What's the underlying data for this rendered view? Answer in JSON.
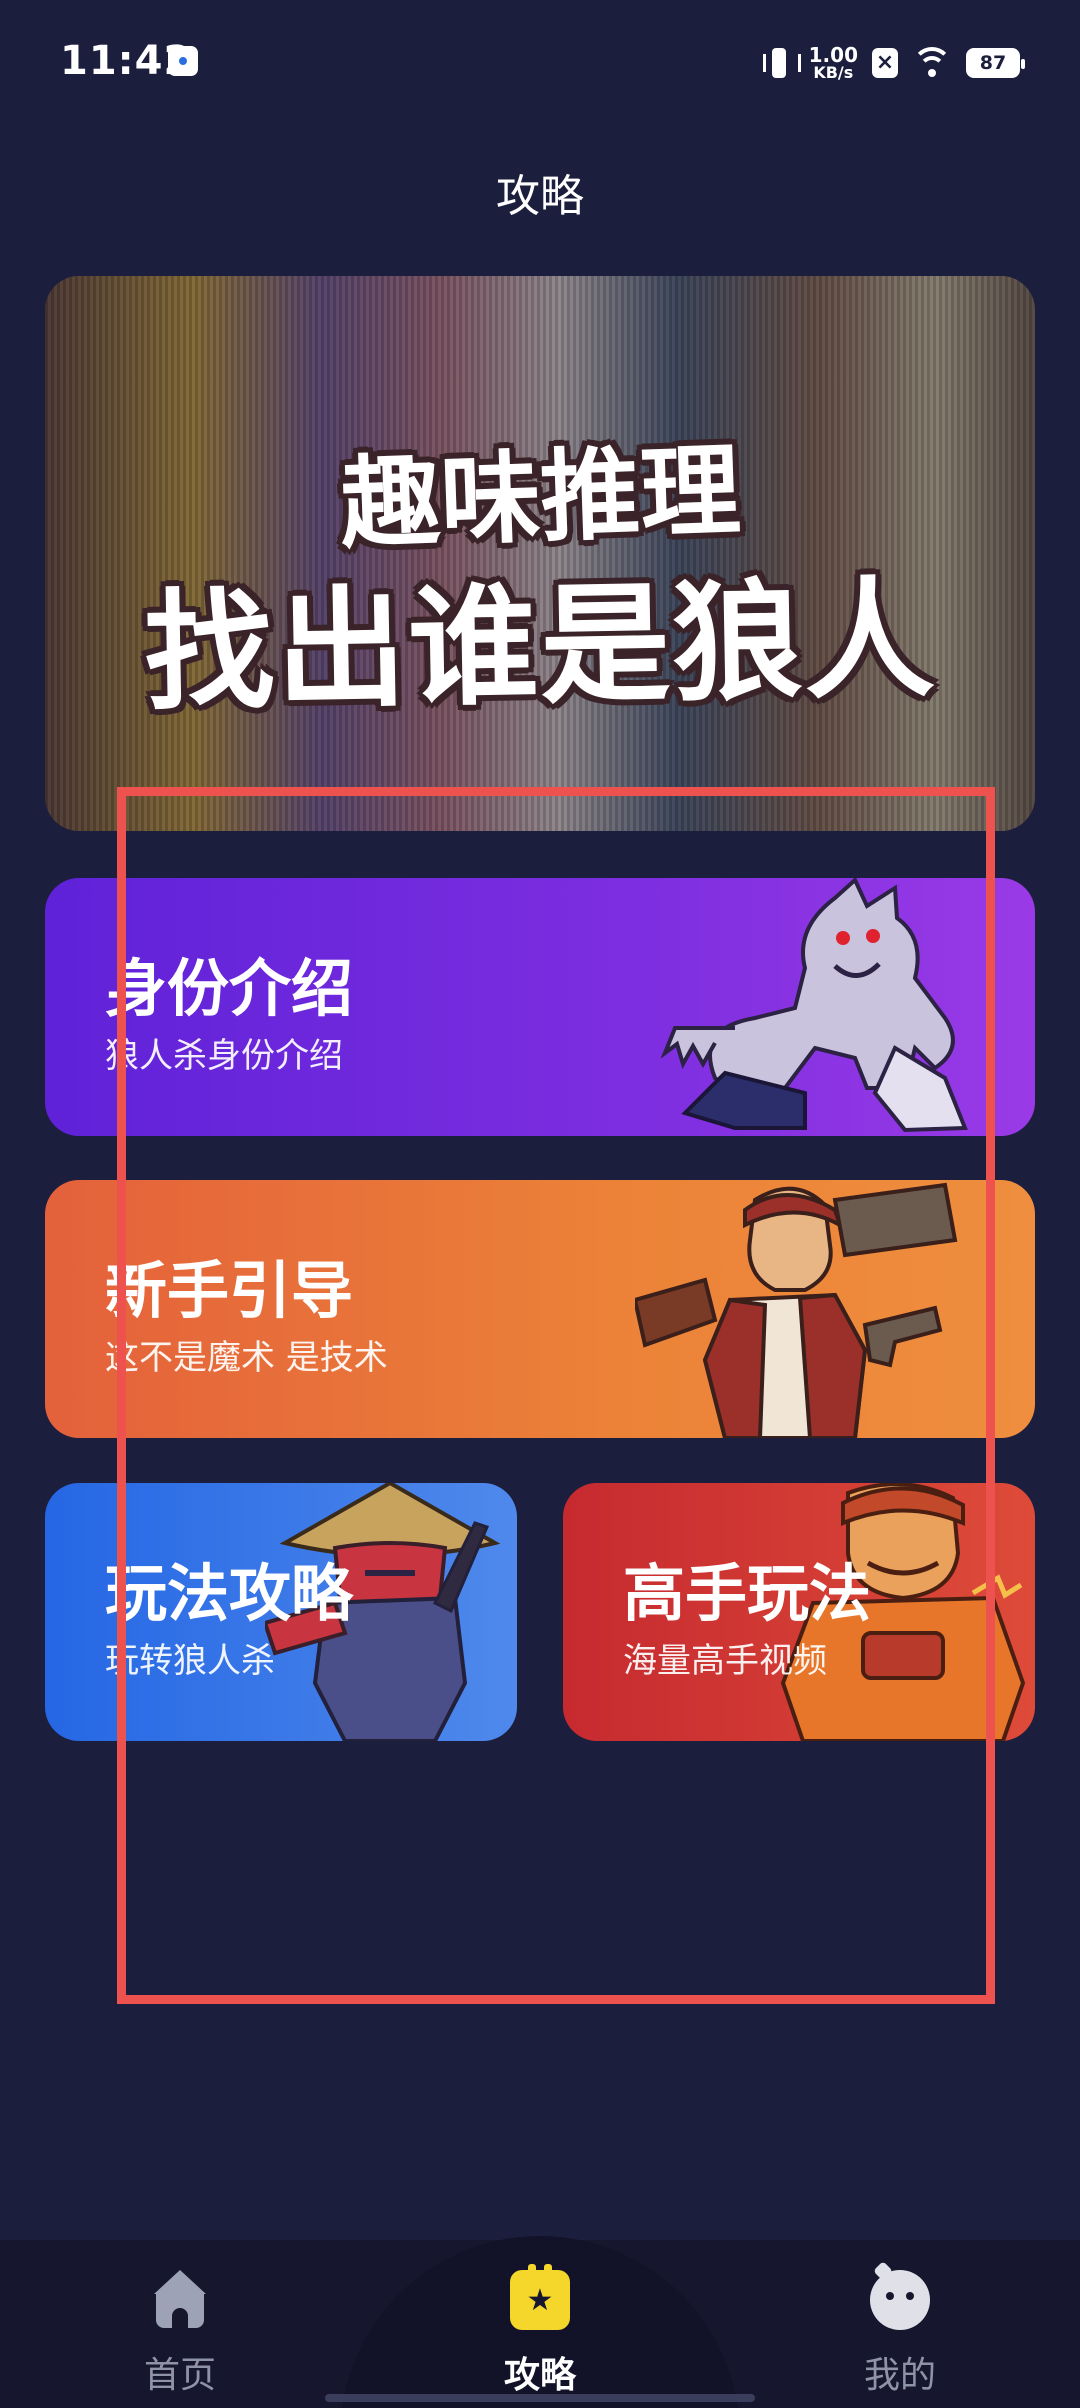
{
  "status_bar": {
    "time": "11:42",
    "net_speed_value": "1.00",
    "net_speed_unit": "KB/s",
    "battery": "87",
    "icons": [
      "app-badge-icon",
      "vibrate-icon",
      "close-box-icon",
      "wifi-icon",
      "battery-icon"
    ]
  },
  "page": {
    "title": "攻略"
  },
  "banner": {
    "line1": "趣味推理",
    "line2": "找出谁是狼人"
  },
  "cards": {
    "identity": {
      "title": "身份介绍",
      "subtitle": "狼人杀身份介绍",
      "art": "werewolf-character"
    },
    "newbie": {
      "title": "新手引导",
      "subtitle": "这不是魔术 是技术",
      "art": "gunslinger-character"
    },
    "guide": {
      "title": "玩法攻略",
      "subtitle": "玩转狼人杀",
      "art": "ninja-character"
    },
    "pro": {
      "title": "高手玩法",
      "subtitle": "海量高手视频",
      "art": "bomber-character"
    }
  },
  "bottom_nav": {
    "items": [
      {
        "label": "首页",
        "icon": "home-icon",
        "active": false
      },
      {
        "label": "攻略",
        "icon": "guide-star-icon",
        "active": true
      },
      {
        "label": "我的",
        "icon": "profile-icon",
        "active": false
      }
    ]
  },
  "colors": {
    "background": "#1c1e3e",
    "identity_card": "#6d28dc",
    "newbie_card": "#e8733a",
    "guide_card": "#3a79e8",
    "pro_card": "#d23a34",
    "highlight_outline": "#ed524e",
    "nav_active_icon": "#f5d62b"
  }
}
